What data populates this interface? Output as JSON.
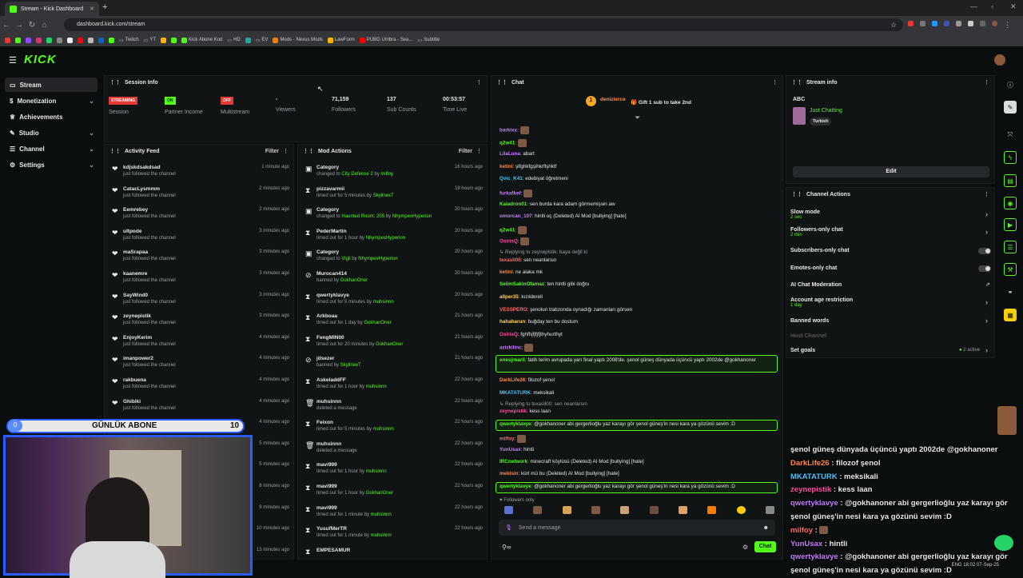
{
  "browser": {
    "tab_title": "Stream - Kick Dashboard",
    "url": "dashboard.kick.com/stream",
    "bookmarks": [
      "Twitch",
      "YT",
      "Kick Abone Kod",
      "HD",
      "EV",
      "Mods - Nexus Mods",
      "LawForm",
      "PUBG Umbra - Sea...",
      "Subtitle"
    ]
  },
  "brand": {
    "logo": "KICK",
    "accent": "#53fc18"
  },
  "sidebar": {
    "items": [
      {
        "label": "Stream"
      },
      {
        "label": "Monetization"
      },
      {
        "label": "Achievements"
      },
      {
        "label": "Studio"
      },
      {
        "label": "Channel"
      },
      {
        "label": "Settings"
      }
    ]
  },
  "session": {
    "title": "Session Info",
    "stats": [
      {
        "badge": "STREAMING",
        "label": "Session"
      },
      {
        "badge": "ON",
        "label": "Partner Income"
      },
      {
        "badge": "OFF",
        "label": "Multistream"
      },
      {
        "value": "-",
        "label": "Viewers"
      },
      {
        "value": "71,159",
        "label": "Followers"
      },
      {
        "value": "137",
        "label": "Sub Counts"
      },
      {
        "value": "00:53:57",
        "label": "Time Live"
      }
    ]
  },
  "activity": {
    "title": "Activity Feed",
    "filter": "Filter",
    "items": [
      {
        "name": "kdjskdsakdsad",
        "sub": "just followed the channel",
        "time": "1 minute ago"
      },
      {
        "name": "CatacLysmmm",
        "sub": "just followed the channel",
        "time": "2 minutes ago"
      },
      {
        "name": "Eemrebey",
        "sub": "just followed the channel",
        "time": "2 minutes ago"
      },
      {
        "name": "ultpode",
        "sub": "just followed the channel",
        "time": "3 minutes ago"
      },
      {
        "name": "maSrapaa",
        "sub": "just followed the channel",
        "time": "3 minutes ago"
      },
      {
        "name": "kaanemre",
        "sub": "just followed the channel",
        "time": "3 minutes ago"
      },
      {
        "name": "SayWind0",
        "sub": "just followed the channel",
        "time": "3 minutes ago"
      },
      {
        "name": "zeynepistik",
        "sub": "just followed the channel",
        "time": "3 minutes ago"
      },
      {
        "name": "EnjoyKerim",
        "sub": "just followed the channel",
        "time": "4 minutes ago"
      },
      {
        "name": "imanpower2",
        "sub": "just followed the channel",
        "time": "4 minutes ago"
      },
      {
        "name": "rakbuena",
        "sub": "just followed the channel",
        "time": "4 minutes ago"
      },
      {
        "name": "Ghibiki",
        "sub": "just followed the channel",
        "time": "4 minutes ago"
      },
      {
        "name": "",
        "sub": "",
        "time": "4 minutes ago"
      },
      {
        "name": "",
        "sub": "",
        "time": "5 minutes ago"
      },
      {
        "name": "",
        "sub": "",
        "time": "5 minutes ago"
      },
      {
        "name": "",
        "sub": "",
        "time": "8 minutes ago"
      },
      {
        "name": "",
        "sub": "",
        "time": "9 minutes ago"
      },
      {
        "name": "",
        "sub": "",
        "time": "10 minutes ago"
      },
      {
        "name": "",
        "sub": "",
        "time": "13 minutes ago"
      }
    ]
  },
  "mod": {
    "title": "Mod Actions",
    "filter": "Filter",
    "items": [
      {
        "icon": "▣",
        "name": "Category",
        "pre": "changed to ",
        "obj": "City Defense 2",
        "by": " by ",
        "mod": "milfoy",
        "time": "16 hours ago"
      },
      {
        "icon": "⧗",
        "name": "pizzavarmii",
        "pre": "timed out for 5 minutes by ",
        "obj": "",
        "by": "",
        "mod": "SkylinexT",
        "time": "19 hours ago"
      },
      {
        "icon": "▣",
        "name": "Category",
        "pre": "changed to ",
        "obj": "Haunted Room: 205",
        "by": " by ",
        "mod": "NhympexHyperion",
        "time": "20 hours ago"
      },
      {
        "icon": "⧗",
        "name": "PederMartin",
        "pre": "timed out for 1 hour by ",
        "obj": "",
        "by": "",
        "mod": "NhympexHyperion",
        "time": "20 hours ago"
      },
      {
        "icon": "▣",
        "name": "Category",
        "pre": "changed to ",
        "obj": "Vigil",
        "by": " by ",
        "mod": "NhympexHyperion",
        "time": "20 hours ago"
      },
      {
        "icon": "⊘",
        "name": "Murocan414",
        "pre": "banned by ",
        "obj": "",
        "by": "",
        "mod": "GokhanOner",
        "time": "20 hours ago"
      },
      {
        "icon": "⧗",
        "name": "qwertyklavye",
        "pre": "timed out for 5 minutes by ",
        "obj": "",
        "by": "",
        "mod": "muhsinnn",
        "time": "20 hours ago"
      },
      {
        "icon": "⧗",
        "name": "Arkboaa",
        "pre": "timed out for 1 day by ",
        "obj": "",
        "by": "",
        "mod": "GokhanOner",
        "time": "21 hours ago"
      },
      {
        "icon": "⧗",
        "name": "FengMIN00",
        "pre": "timed out for 20 minutes by ",
        "obj": "",
        "by": "",
        "mod": "GokhanOner",
        "time": "21 hours ago"
      },
      {
        "icon": "⊘",
        "name": "jdsezer",
        "pre": "banned by ",
        "obj": "",
        "by": "",
        "mod": "SkylinexT",
        "time": "21 hours ago"
      },
      {
        "icon": "⧗",
        "name": "AskeladdFF",
        "pre": "timed out for 1 hour by ",
        "obj": "",
        "by": "",
        "mod": "muhsinnn",
        "time": "22 hours ago"
      },
      {
        "icon": "🗑",
        "name": "muhsinnn",
        "pre": "deleted a message",
        "obj": "",
        "by": "",
        "mod": "",
        "time": "22 hours ago"
      },
      {
        "icon": "⧗",
        "name": "Feixon",
        "pre": "timed out for 5 minutes by ",
        "obj": "",
        "by": "",
        "mod": "muhsinnn",
        "time": "22 hours ago"
      },
      {
        "icon": "🗑",
        "name": "muhsinnn",
        "pre": "deleted a message",
        "obj": "",
        "by": "",
        "mod": "",
        "time": "22 hours ago"
      },
      {
        "icon": "⧗",
        "name": "mavi999",
        "pre": "timed out for 1 hour by ",
        "obj": "",
        "by": "",
        "mod": "muhsinnn",
        "time": "22 hours ago"
      },
      {
        "icon": "⧗",
        "name": "mavi999",
        "pre": "timed out for 1 hour by ",
        "obj": "",
        "by": "",
        "mod": "GokhanOner",
        "time": "22 hours ago"
      },
      {
        "icon": "⧗",
        "name": "mavi999",
        "pre": "timed out for 1 minute by ",
        "obj": "",
        "by": "",
        "mod": "muhsinnn",
        "time": "22 hours ago"
      },
      {
        "icon": "⧗",
        "name": "YusufMerTR",
        "pre": "timed out for 1 minute by ",
        "obj": "",
        "by": "",
        "mod": "muhsinnn",
        "time": "22 hours ago"
      },
      {
        "icon": "⧗",
        "name": "EMPESAMUR",
        "pre": "",
        "obj": "",
        "by": "",
        "mod": "",
        "time": ""
      }
    ]
  },
  "chat": {
    "title": "Chat",
    "gift_user": "denizierce",
    "gift_count": "1",
    "gift_text": "Gift 1 sub to take 2nd",
    "followers_only": "Followers only",
    "placeholder": "Send a message",
    "send": "Chat",
    "messages": [
      {
        "u": "barkixx",
        "c": "#c77dff",
        "t": ""
      },
      {
        "u": "q2w41",
        "c": "#53fc18",
        "t": ""
      },
      {
        "u": "LilaLuna",
        "c": "#c77dff",
        "t": "abart"
      },
      {
        "u": "ketini",
        "c": "#ff8c42",
        "t": "şlfghkfgşihkrflşhktf"
      },
      {
        "u": "Qvic_K41",
        "c": "#4fc3f7",
        "t": "edebiyat öğretmeni"
      },
      {
        "u": "furkafkef",
        "c": "#c77dff",
        "t": ""
      },
      {
        "u": "Kaladron01",
        "c": "#53fc18",
        "t": "sen burda kara adam görmemişsin aw"
      },
      {
        "u": "omorcan_107",
        "c": "#c77dff",
        "t": "hintli oç (Deleted) AI Mod [bullying] [hate]"
      },
      {
        "u": "q2w41",
        "c": "#53fc18",
        "t": ""
      },
      {
        "u": "OsirisQ",
        "c": "#ff4fa3",
        "t": ""
      },
      {
        "u": "",
        "c": "#9aa0a6",
        "t": "↳ Replying to zeynepistik: baya değil ki"
      },
      {
        "u": "texasli00",
        "c": "#ff6b6b",
        "t": "sen neanlarsın"
      },
      {
        "u": "ketini",
        "c": "#ff8c42",
        "t": "ne alaka mk"
      },
      {
        "u": "SelimSakinOlamaz",
        "c": "#53fc18",
        "t": "ten hintli gibi doğru"
      },
      {
        "u": "allper35",
        "c": "#ffd54f",
        "t": "kızıldereli"
      },
      {
        "u": "VESSPERO",
        "c": "#ff6b6b",
        "t": "şenolun trabzonda oynadığı zamanları görsen"
      },
      {
        "u": "hahaharun",
        "c": "#ffd54f",
        "t": "buğday ten bu dostum"
      },
      {
        "u": "OsirisQ",
        "c": "#ff4fa3",
        "t": "fghfhjfjfjfjthyhurthyt"
      },
      {
        "u": "azizkilinc",
        "c": "#c77dff",
        "t": ""
      },
      {
        "u": "enesjrnarli",
        "c": "#53fc18",
        "t": "fatih terim avrupada yarı final yaptı 2008'de. şenol güneş dünyada üçüncü yaptı 2002de @gokhanoner"
      },
      {
        "u": "DarkLife26",
        "c": "#ff8c42",
        "t": "filozof şenol"
      },
      {
        "u": "MKATATURK",
        "c": "#4fc3f7",
        "t": "meksikali"
      },
      {
        "u": "",
        "c": "#9aa0a6",
        "t": "↳ Replying to texasli00: sen neanlarsın"
      },
      {
        "u": "zeynepistik",
        "c": "#ff4fa3",
        "t": "kess laan"
      },
      {
        "u": "qwertyklavye",
        "c": "#53fc18",
        "t": "@gokhanoner abi gergerlioğlu yaz karayı gör şenol güneş'in nesi kara ya gözünü sevim :D"
      },
      {
        "u": "milfoy",
        "c": "#ff6b6b",
        "t": ""
      },
      {
        "u": "YunUsax",
        "c": "#c77dff",
        "t": "hintli"
      },
      {
        "u": "IRCnetwork",
        "c": "#53fc18",
        "t": "minecraft köylüsü (Deleted) AI Mod [bullying] [hate]"
      },
      {
        "u": "mekisin",
        "c": "#ff8c42",
        "t": "kürt mü bu (Deleted) AI Mod [bullying] [hate]"
      },
      {
        "u": "qwertyklavye",
        "c": "#53fc18",
        "t": "@gokhanoner abi gergerlioğlu yaz karayı gör şenol güneş'in nesi kara ya gözünü sevim :D"
      }
    ]
  },
  "streaminfo": {
    "title": "Stream info",
    "stream_title": "ABC",
    "category": "Just Chatting",
    "tag": "Turkish",
    "edit": "Edit"
  },
  "channelactions": {
    "title": "Channel Actions",
    "items": [
      {
        "label": "Slow mode",
        "sub": "2 sec"
      },
      {
        "label": "Followers-only chat",
        "sub": "2 min"
      },
      {
        "label": "Subscribers-only chat",
        "sub": ""
      },
      {
        "label": "Emotes-only chat",
        "sub": ""
      },
      {
        "label": "AI Chat Moderation",
        "sub": ""
      },
      {
        "label": "Account age restriction",
        "sub": "1 day"
      },
      {
        "label": "Banned words",
        "sub": ""
      },
      {
        "label": "Host Channel",
        "sub": ""
      },
      {
        "label": "Set goals",
        "sub": ""
      }
    ],
    "goals_active": "2 active"
  },
  "overlay": {
    "goal_left": "0",
    "goal_label": "GÜNLÜK ABONE",
    "goal_right": "10",
    "chat": [
      {
        "u": "",
        "c": "#fff",
        "t": "şenol güneş dünyada üçüncü yaptı 2002de @gokhanoner"
      },
      {
        "u": "DarkLife26",
        "c": "#ff8c42",
        "t": "filozof şenol"
      },
      {
        "u": "MKATATURK",
        "c": "#4fc3f7",
        "t": "meksikali"
      },
      {
        "u": "zeynepistik",
        "c": "#ff4fa3",
        "t": "kess laan"
      },
      {
        "u": "qwertyklavye",
        "c": "#c77dff",
        "t": "@gokhanoner abi gergerlioğlu yaz karayı gör"
      },
      {
        "u": "",
        "c": "#fff",
        "t": "şenol güneş'in nesi kara ya gözünü sevim :D"
      },
      {
        "u": "milfoy",
        "c": "#ff6b6b",
        "t": ""
      },
      {
        "u": "YunUsax",
        "c": "#c77dff",
        "t": "hintli"
      },
      {
        "u": "qwertyklavye",
        "c": "#c77dff",
        "t": "@gokhanoner abi gergerlioğlu yaz karayı gör"
      },
      {
        "u": "",
        "c": "#fff",
        "t": "şenol güneş'in nesi kara ya gözünü sevim :D"
      }
    ]
  },
  "taskbar": {
    "lang": "ENG",
    "time": "18:02",
    "date": "07-Sep-25"
  }
}
